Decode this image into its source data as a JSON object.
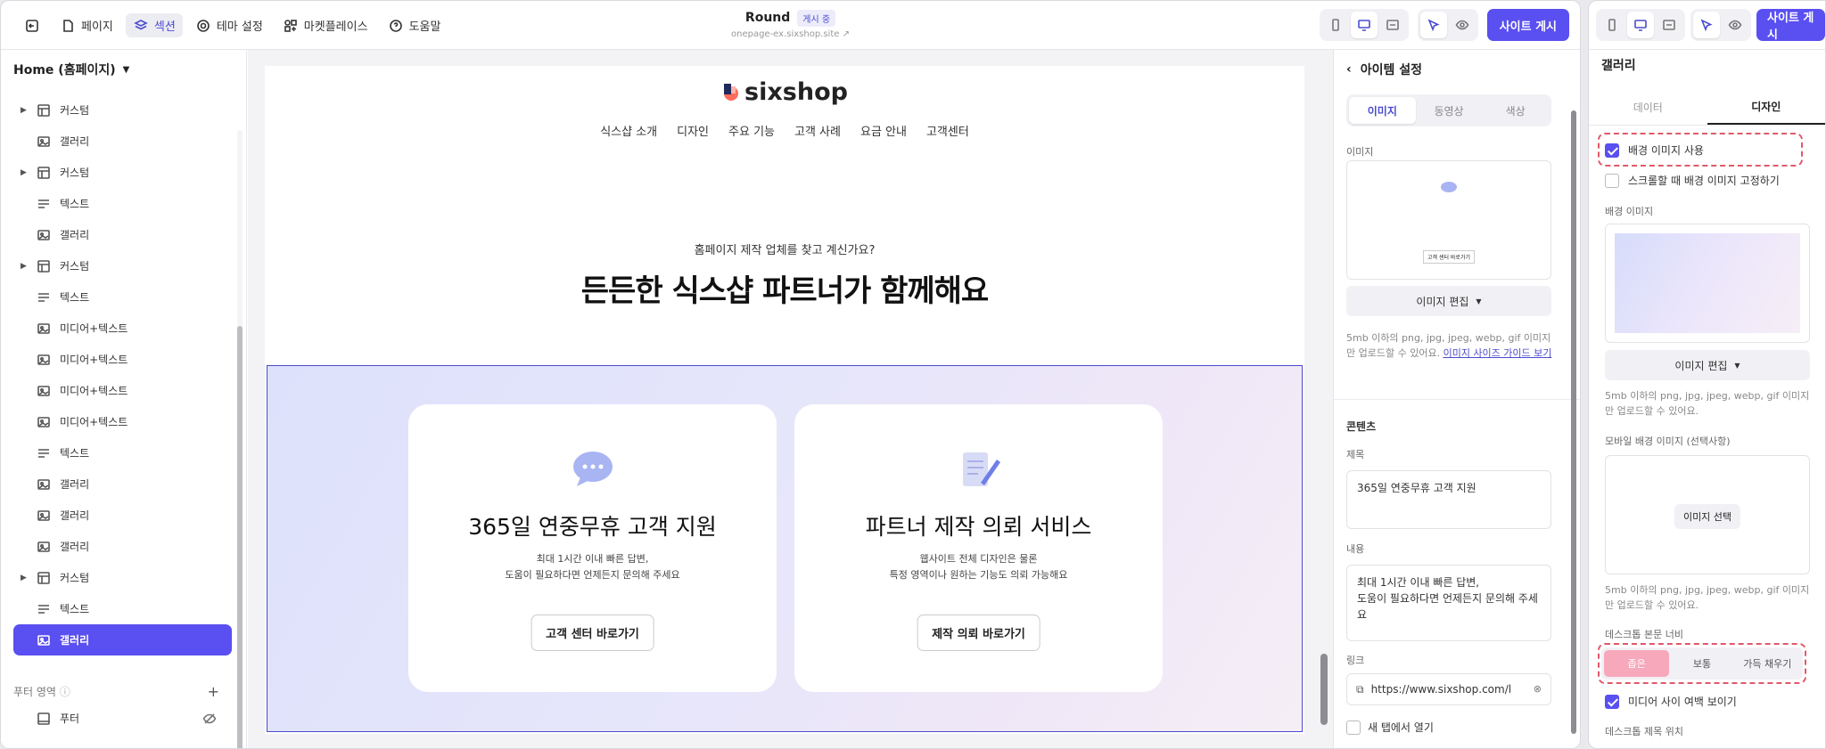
{
  "topbar": {
    "menu": [
      {
        "label": "페이지",
        "icon": "file-icon"
      },
      {
        "label": "섹션",
        "icon": "layers-icon",
        "active": true
      },
      {
        "label": "테마 설정",
        "icon": "gear-icon"
      },
      {
        "label": "마켓플레이스",
        "icon": "grid-icon"
      },
      {
        "label": "도움말",
        "icon": "help-icon"
      }
    ],
    "site_title": "Round",
    "status_badge": "게시 중",
    "site_url": "onepage-ex.sixshop.site",
    "publish_label": "사이트 게시"
  },
  "sidebar": {
    "page_select": "Home (홈페이지)",
    "items": [
      {
        "label": "커스텀",
        "icon": "layout-icon",
        "expandable": true
      },
      {
        "label": "갤러리",
        "icon": "image-icon"
      },
      {
        "label": "커스텀",
        "icon": "layout-icon",
        "expandable": true
      },
      {
        "label": "텍스트",
        "icon": "text-icon"
      },
      {
        "label": "갤러리",
        "icon": "image-icon"
      },
      {
        "label": "커스텀",
        "icon": "layout-icon",
        "expandable": true
      },
      {
        "label": "텍스트",
        "icon": "text-icon"
      },
      {
        "label": "미디어+텍스트",
        "icon": "image-icon"
      },
      {
        "label": "미디어+텍스트",
        "icon": "image-icon"
      },
      {
        "label": "미디어+텍스트",
        "icon": "image-icon"
      },
      {
        "label": "미디어+텍스트",
        "icon": "image-icon"
      },
      {
        "label": "텍스트",
        "icon": "text-icon"
      },
      {
        "label": "갤러리",
        "icon": "image-icon"
      },
      {
        "label": "갤러리",
        "icon": "image-icon"
      },
      {
        "label": "갤러리",
        "icon": "image-icon"
      },
      {
        "label": "커스텀",
        "icon": "layout-icon",
        "expandable": true
      },
      {
        "label": "텍스트",
        "icon": "text-icon"
      },
      {
        "label": "갤러리",
        "icon": "image-icon",
        "selected": true
      }
    ],
    "footer_section_label": "푸터 영역",
    "footer_item": "푸터"
  },
  "canvas": {
    "logo_text": "sixshop",
    "nav": [
      "식스샵 소개",
      "디자인",
      "주요 기능",
      "고객 사례",
      "요금 안내",
      "고객센터"
    ],
    "hero_sub": "홈페이지 제작 업체를 찾고 계신가요?",
    "hero_title": "든든한 식스샵 파트너가 함께해요",
    "cards": [
      {
        "title": "365일 연중무휴 고객 지원",
        "desc1": "최대 1시간 이내 빠른 답변,",
        "desc2": "도움이 필요하다면 언제든지 문의해 주세요",
        "button": "고객 센터 바로가기",
        "icon": "chat-bubble-icon"
      },
      {
        "title": "파트너 제작 의뢰 서비스",
        "desc1": "웹사이트 전체 디자인은 물론",
        "desc2": "특정 영역이나 원하는 기능도 의뢰 가능해요",
        "button": "제작 의뢰 바로가기",
        "icon": "document-pen-icon"
      }
    ]
  },
  "item_panel": {
    "title": "아이템 설정",
    "tabs": [
      "이미지",
      "동영상",
      "색상"
    ],
    "image_label": "이미지",
    "thumb_text": "고객 센터 바로가기",
    "edit_image": "이미지 편집",
    "help_text": "5mb 이하의 png, jpg, jpeg, webp, gif 이미지만 업로드할 수 있어요.",
    "help_link": "이미지 사이즈 가이드 보기",
    "content_title": "콘텐츠",
    "title_label": "제목",
    "title_value": "365일 연중무휴 고객 지원",
    "body_label": "내용",
    "body_value": "최대 1시간 이내 빠른 답변,\n도움이 필요하다면 언제든지 문의해 주세요",
    "link_label": "링크",
    "link_value": "https://www.sixshop.com/l",
    "new_tab_label": "새 탭에서 열기"
  },
  "gallery_panel": {
    "title": "갤러리",
    "tabs": [
      "데이터",
      "디자인"
    ],
    "publish_label": "사이트 게시",
    "use_bg_image": "배경 이미지 사용",
    "fix_bg": "스크롤할 때 배경 이미지 고정하기",
    "bg_image_label": "배경 이미지",
    "edit_image": "이미지 편집",
    "help_text": "5mb 이하의 png, jpg, jpeg, webp, gif 이미지만 업로드할 수 있어요.",
    "mobile_bg_label": "모바일 배경 이미지 (선택사항)",
    "select_image": "이미지 선택",
    "help_text2": "5mb 이하의 png, jpg, jpeg, webp, gif 이미지만 업로드할 수 있어요.",
    "desktop_width_label": "데스크톱 본문 너비",
    "width_options": [
      "좁은",
      "보통",
      "가득 채우기"
    ],
    "media_gap": "미디어 사이 여백 보이기",
    "desktop_title_pos": "데스크톱 제목 위치"
  },
  "colors": {
    "accent": "#5a4ff0",
    "highlight": "#e0596a"
  }
}
